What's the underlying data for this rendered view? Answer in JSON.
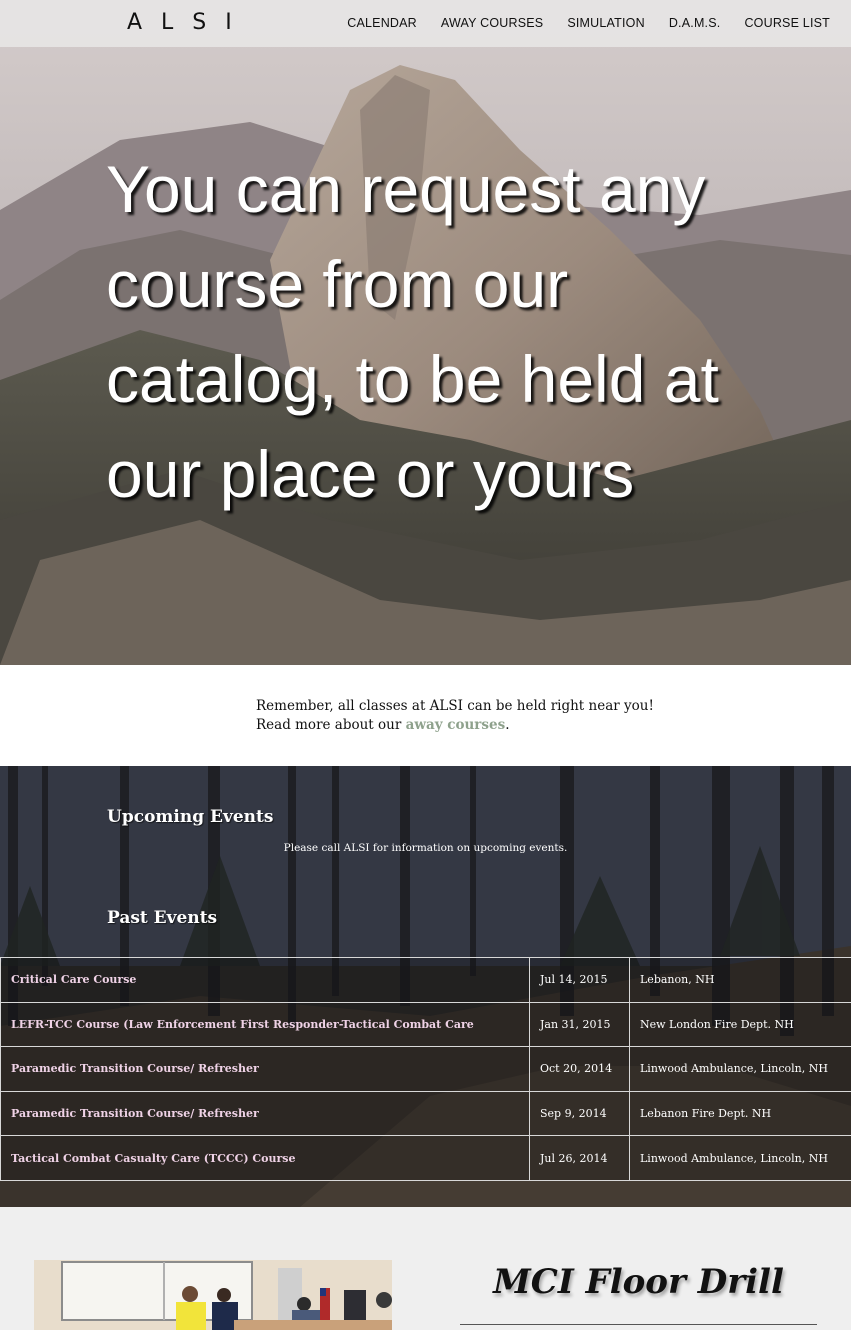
{
  "site": {
    "logo": "ALSI"
  },
  "nav": {
    "items": [
      {
        "label": "CALENDAR"
      },
      {
        "label": "AWAY COURSES"
      },
      {
        "label": "SIMULATION"
      },
      {
        "label": "D.A.M.S."
      },
      {
        "label": "COURSE LIST"
      }
    ]
  },
  "hero": {
    "headline": "You can request any course from our catalog, to be held at our place or yours"
  },
  "intro": {
    "line1": "Remember, all classes at ALSI can be held right near you!",
    "line2_prefix": "Read more about our ",
    "link_text": "away courses",
    "line2_suffix": ".",
    "link_color": "#8ea18c"
  },
  "upcoming": {
    "heading": "Upcoming Events",
    "note": "Please call ALSI for information on upcoming events."
  },
  "past": {
    "heading": "Past Events",
    "rows": [
      {
        "name": "Critical Care Course",
        "date": "Jul 14, 2015",
        "location": "Lebanon, NH"
      },
      {
        "name": "LEFR-TCC Course (Law Enforcement First Responder-Tactical Combat Care",
        "date": "Jan 31, 2015",
        "location": "New London Fire Dept. NH"
      },
      {
        "name": "Paramedic Transition Course/ Refresher",
        "date": "Oct 20, 2014",
        "location": "Linwood Ambulance, Lincoln, NH"
      },
      {
        "name": "Paramedic Transition Course/ Refresher",
        "date": "Sep 9, 2014",
        "location": "Lebanon Fire Dept. NH"
      },
      {
        "name": "Tactical Combat Casualty Care (TCCC) Course",
        "date": "Jul 26, 2014",
        "location": "Linwood Ambulance, Lincoln, NH"
      }
    ]
  },
  "feature": {
    "title": "MCI Floor Drill"
  }
}
